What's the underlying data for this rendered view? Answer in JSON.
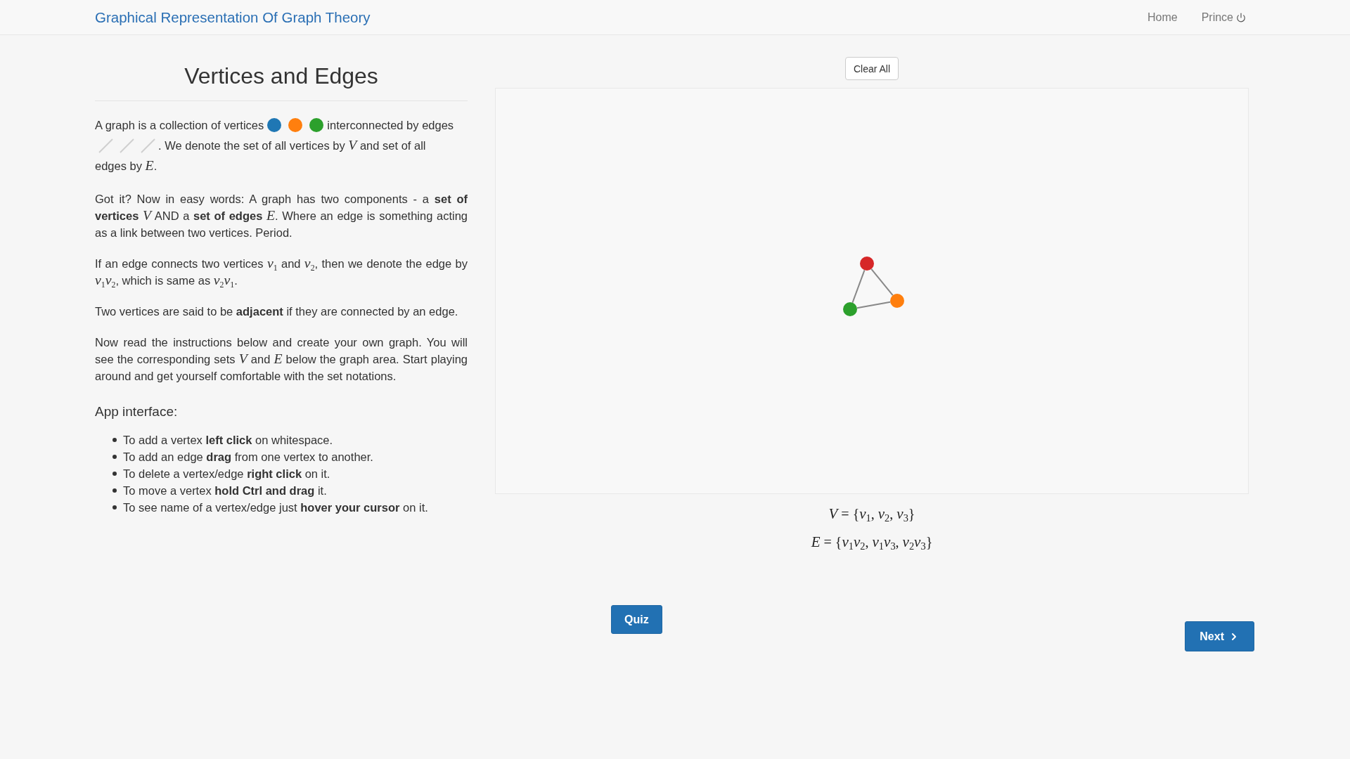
{
  "navbar": {
    "brand": "Graphical Representation Of Graph Theory",
    "links": [
      {
        "kind": "plain",
        "label": "Home"
      },
      {
        "kind": "account",
        "label": "Prince"
      }
    ]
  },
  "lesson": {
    "title": "Vertices and Edges",
    "intro": [
      {
        "kind": "text",
        "text": "A graph is a collection of vertices"
      },
      {
        "kind": "vertex",
        "color": "#1f77b4"
      },
      {
        "kind": "vertex",
        "color": "#ff7f0e"
      },
      {
        "kind": "vertex",
        "color": "#2ca02c"
      },
      {
        "kind": "text",
        "text": "interconnected by edges"
      },
      {
        "kind": "edge"
      },
      {
        "kind": "edge"
      },
      {
        "kind": "edge"
      },
      {
        "kind": "text",
        "text": ". We denote the set of all vertices by *V* and set of all"
      },
      {
        "kind": "line",
        "text": "edges by *E*."
      }
    ],
    "paragraphs": [
      "Got it? Now in easy words: A graph has two components - a **set of vertices** *V* AND a **set of edges** *E*. Where an edge is something acting as a link between two vertices. Period.",
      "If an edge connects two vertices *v*$_{1}$ and *v*$_{2}$, then we denote the edge by *v*$_{1}$*v*$_{2}$, which is same as *v*$_{2}$*v*$_{1}$.",
      "Two vertices are said to be **adjacent** if they are connected by an edge.",
      "Now read the instructions below and create your own graph. You will see the corresponding sets *V* and *E* below the graph area. Start playing around and get yourself comfortable with the set notations."
    ],
    "interface_heading": "App interface:",
    "instructions": [
      "To add a vertex **left click** on whitespace.",
      "To add an edge **drag** from one vertex to another.",
      "To delete a vertex/edge **right click** on it.",
      "To move a vertex **hold Ctrl and drag** it.",
      "To see name of a vertex/edge just **hover your cursor** on it."
    ]
  },
  "workspace": {
    "clear_button": "Clear All",
    "graph": {
      "vertices": [
        {
          "color": "#d62728"
        },
        {
          "color": "#ff7f0e"
        },
        {
          "color": "#2ca02c"
        }
      ]
    },
    "sets": [
      "*V* = {*v*$_{1}$, *v*$_{2}$, *v*$_{3}$}",
      "*E* = {*v*$_{1}$*v*$_{2}$, *v*$_{1}$*v*$_{3}$, *v*$_{2}$*v*$_{3}$}"
    ]
  },
  "quiz_button": "Quiz",
  "next_button": "Next"
}
